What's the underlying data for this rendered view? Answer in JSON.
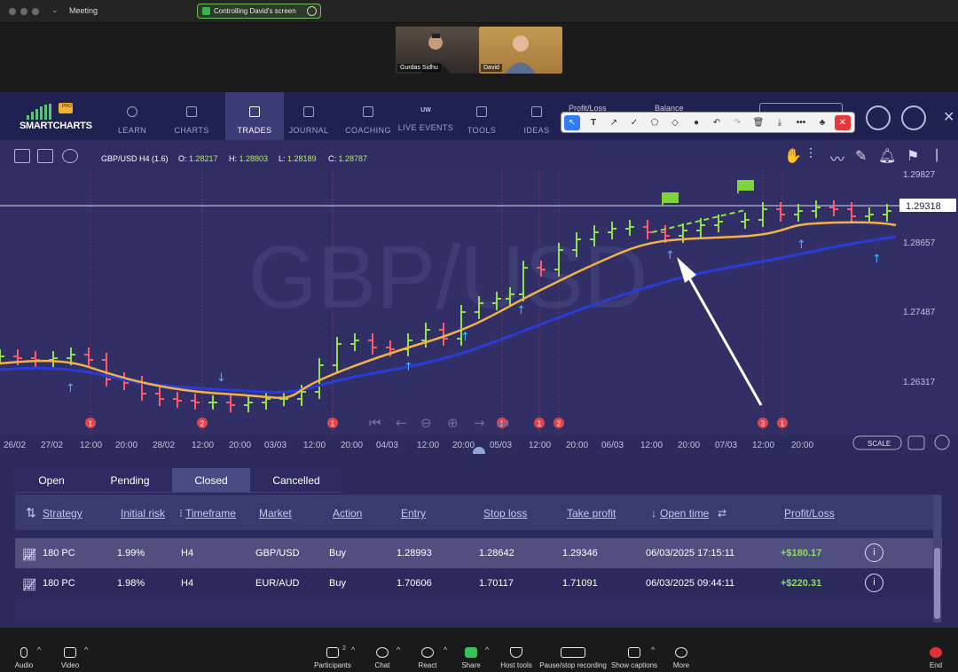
{
  "zoom": {
    "meeting_label": "Meeting",
    "control_banner": "Controlling David's screen",
    "participants": [
      {
        "name": "Gurdas Sidhu"
      },
      {
        "name": "David"
      }
    ],
    "bottom_bar": [
      {
        "id": "audio",
        "label": "Audio"
      },
      {
        "id": "video",
        "label": "Video"
      },
      {
        "id": "participants",
        "label": "Participants",
        "badge": "2"
      },
      {
        "id": "chat",
        "label": "Chat"
      },
      {
        "id": "react",
        "label": "React"
      },
      {
        "id": "share",
        "label": "Share"
      },
      {
        "id": "host_tools",
        "label": "Host tools"
      },
      {
        "id": "pause_recording",
        "label": "Pause/stop recording"
      },
      {
        "id": "captions",
        "label": "Show captions"
      },
      {
        "id": "more",
        "label": "More"
      },
      {
        "id": "end",
        "label": "End"
      }
    ]
  },
  "app": {
    "logo": "SMARTCHARTS",
    "logo_badge": "PRO",
    "nav": [
      {
        "id": "learn",
        "label": "LEARN"
      },
      {
        "id": "charts",
        "label": "CHARTS"
      },
      {
        "id": "trades",
        "label": "TRADES",
        "active": true
      },
      {
        "id": "journal",
        "label": "JOURNAL"
      },
      {
        "id": "coaching",
        "label": "COACHING"
      },
      {
        "id": "live_events",
        "label": "LIVE EVENTS",
        "prefix": "UW"
      },
      {
        "id": "tools",
        "label": "TOOLS"
      },
      {
        "id": "ideas",
        "label": "IDEAS"
      }
    ],
    "header_labels": {
      "profit_loss": "Profit/Loss",
      "balance": "Balance"
    }
  },
  "chart": {
    "symbol_label": "GBP/USD H4 (1.6)",
    "ohlc": {
      "o_label": "O:",
      "o": "1.28217",
      "h_label": "H:",
      "h": "1.28803",
      "l_label": "L:",
      "l": "1.28189",
      "c_label": "C:",
      "c": "1.28787"
    },
    "watermark": "GBP/USD",
    "scale_btn": "SCALE",
    "current_price": "1.29318",
    "price_axis": [
      "1.29827",
      "1.28657",
      "1.27487",
      "1.26317"
    ],
    "time_axis": [
      "26/02",
      "27/02",
      "12:00",
      "20:00",
      "28/02",
      "12:00",
      "20:00",
      "03/03",
      "12:00",
      "20:00",
      "04/03",
      "12:00",
      "20:00",
      "05/03",
      "12:00",
      "20:00",
      "06/03",
      "12:00",
      "20:00",
      "07/03",
      "12:00",
      "20:00"
    ],
    "event_markers": [
      "1",
      "2",
      "1",
      "1",
      "1",
      "2",
      "3",
      "1"
    ]
  },
  "orders": {
    "tabs": [
      {
        "label": "Open"
      },
      {
        "label": "Pending"
      },
      {
        "label": "Closed",
        "active": true
      },
      {
        "label": "Cancelled"
      }
    ],
    "columns": [
      "Strategy",
      "Initial risk",
      "Timeframe",
      "Market",
      "Action",
      "Entry",
      "Stop loss",
      "Take profit",
      "Open time",
      "Profit/Loss"
    ],
    "rows": [
      {
        "strategy": "180 PC",
        "risk": "1.99%",
        "timeframe": "H4",
        "market": "GBP/USD",
        "action": "Buy",
        "entry": "1.28993",
        "stop": "1.28642",
        "take": "1.29346",
        "open_time": "06/03/2025 17:15:11",
        "pl": "+$180.17"
      },
      {
        "strategy": "180 PC",
        "risk": "1.98%",
        "timeframe": "H4",
        "market": "EUR/AUD",
        "action": "Buy",
        "entry": "1.70606",
        "stop": "1.70117",
        "take": "1.71091",
        "open_time": "06/03/2025 09:44:11",
        "pl": "+$220.31"
      }
    ]
  },
  "colors": {
    "bull": "#8fe04a",
    "bear": "#ff5a6a",
    "ema_fast": "#f2b24a",
    "ema_slow": "#2a3bd6",
    "accent_blue": "#2f7cf6"
  }
}
